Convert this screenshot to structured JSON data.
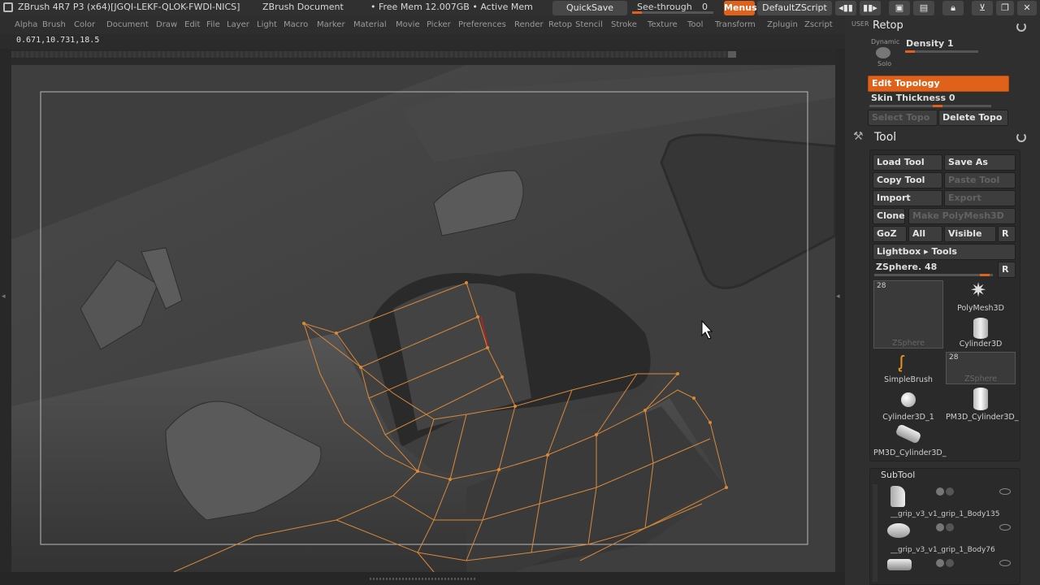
{
  "titlebar": {
    "app_title": "ZBrush 4R7 P3 (x64)[JGQI-LEKF-QLOK-FWDI-NICS]",
    "document": "ZBrush Document",
    "memory": "• Free Mem 12.007GB • Active Mem",
    "quicksave": "QuickSave",
    "see_through": "See-through",
    "see_through_value": "0",
    "menus": "Menus",
    "script": "DefaultZScript"
  },
  "menubar": [
    "Alpha",
    "Brush",
    "Color",
    "Document",
    "Draw",
    "Edit",
    "File",
    "Layer",
    "Light",
    "Macro",
    "Marker",
    "Material",
    "Movie",
    "Picker",
    "Preferences",
    "Render",
    "Retop",
    "Stencil",
    "Stroke",
    "Texture",
    "Tool",
    "Transform",
    "Zplugin",
    "Zscript"
  ],
  "coords": "0.671,10.731,18.5",
  "retop": {
    "user_label": "USER",
    "title": "Retop",
    "dynamic_label": "Dynamic",
    "solo_label": "Solo",
    "density": "Density 1",
    "edit_topology": "Edit Topology",
    "skin_thickness": "Skin Thickness 0",
    "select_topo": "Select Topo",
    "delete_topo": "Delete Topo"
  },
  "tool": {
    "title": "Tool",
    "load_tool": "Load Tool",
    "save_as": "Save As",
    "copy_tool": "Copy Tool",
    "paste_tool": "Paste Tool",
    "import": "Import",
    "export": "Export",
    "clone": "Clone",
    "make_polymesh": "Make PolyMesh3D",
    "goz": "GoZ",
    "all": "All",
    "visible": "Visible",
    "r": "R",
    "lightbox": "Lightbox ▸ Tools",
    "zsphere_slider": "ZSphere. 48",
    "tiles": [
      {
        "label": "ZSphere",
        "count": "28"
      },
      {
        "label": "PolyMesh3D"
      },
      {
        "label": "Cylinder3D"
      },
      {
        "label": "SimpleBrush"
      },
      {
        "label": "ZSphere",
        "count": "28"
      },
      {
        "label": "Cylinder3D_1"
      },
      {
        "label": "PM3D_Cylinder3D_"
      },
      {
        "label": "PM3D_Cylinder3D_"
      }
    ]
  },
  "subtool": {
    "title": "SubTool",
    "items": [
      {
        "label": "__grip_v3_v1_grip_1_Body135"
      },
      {
        "label": "__grip_v3_v1_grip_1_Body76"
      },
      {
        "label": ""
      }
    ]
  },
  "colors": {
    "accent": "#e0621a",
    "topology": "#d8893a",
    "panel": "#2f2f2f"
  }
}
